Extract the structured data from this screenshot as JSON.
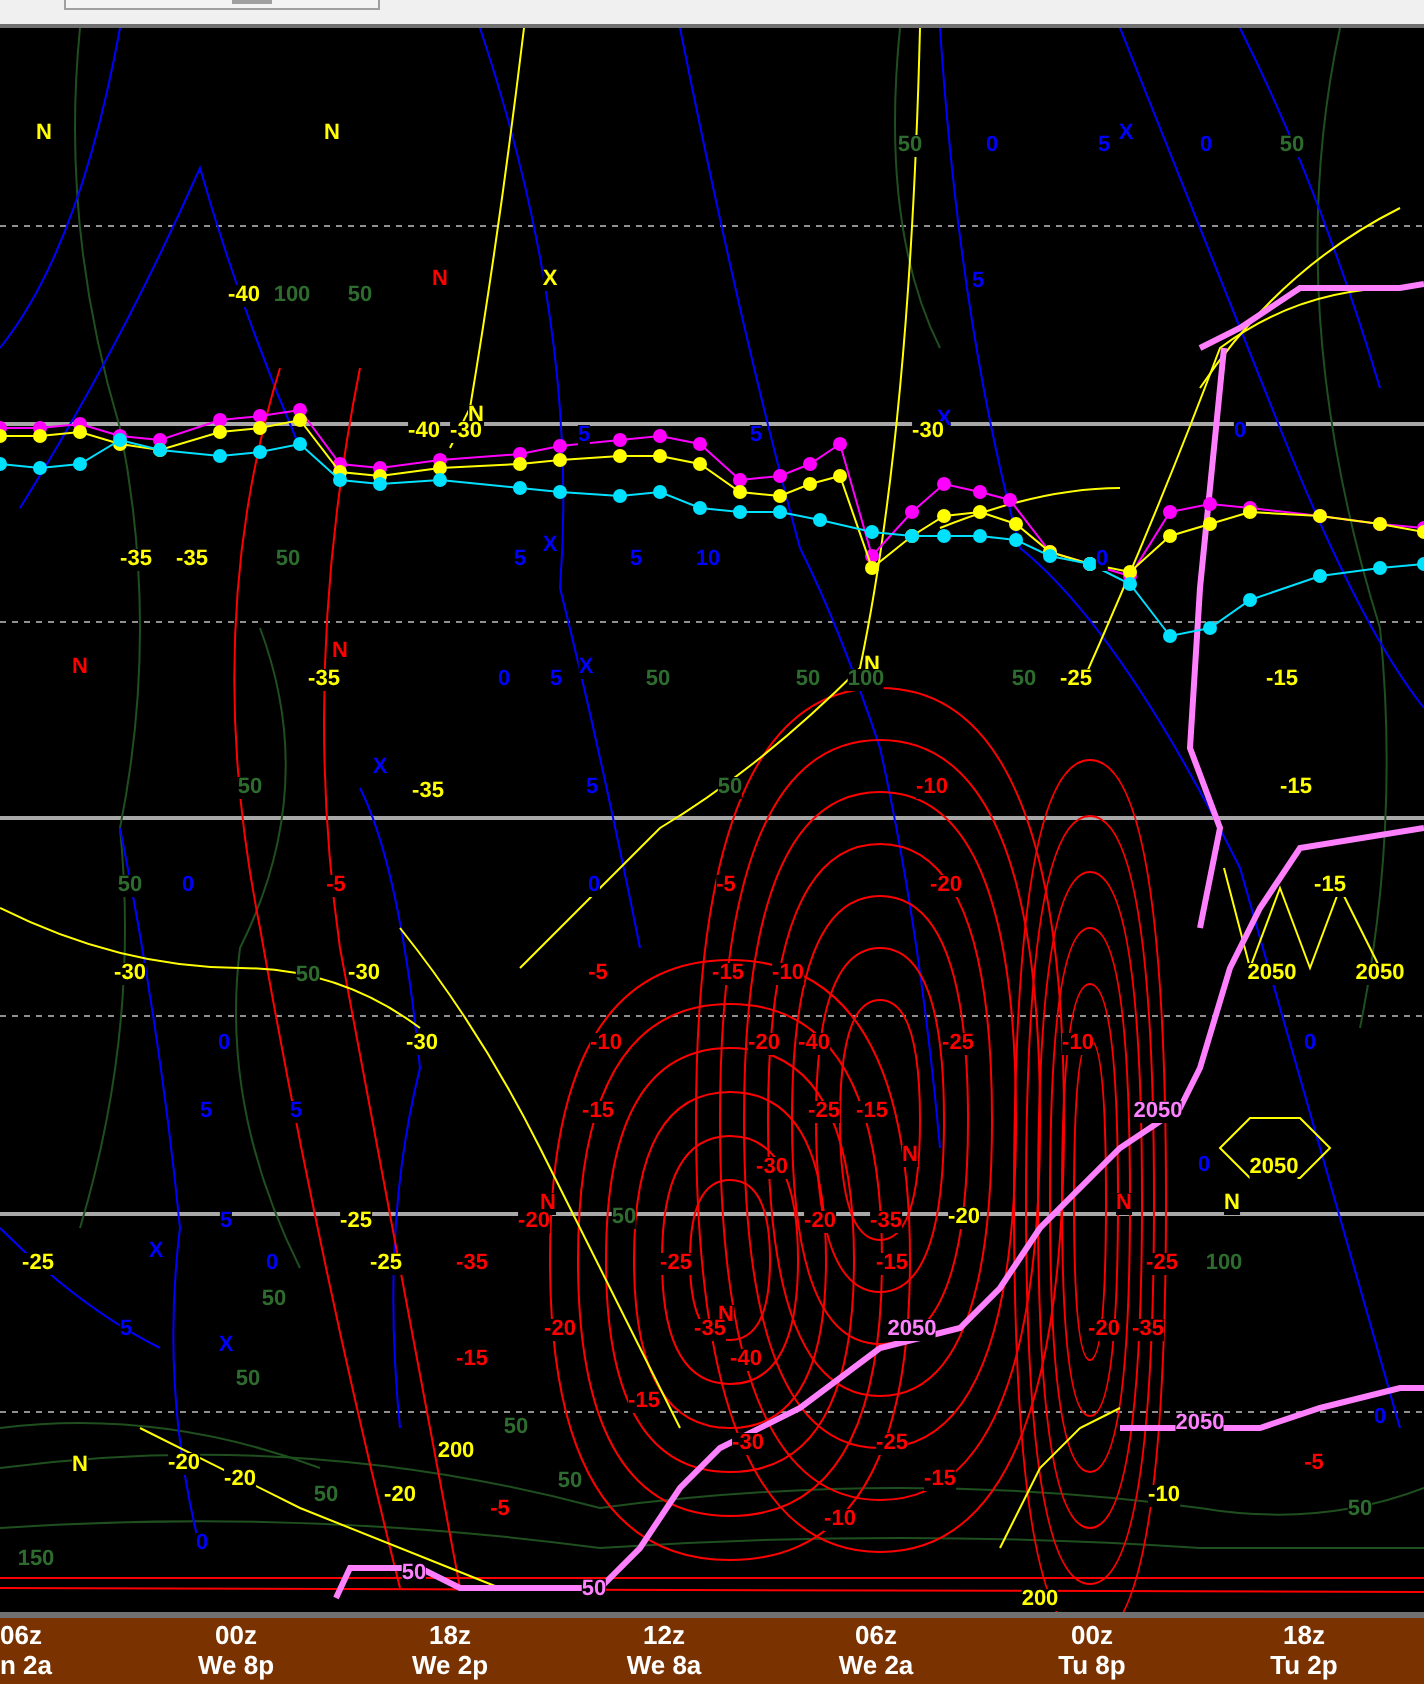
{
  "time_axis": [
    {
      "hour": "06z",
      "day": "n 2a"
    },
    {
      "hour": "00z",
      "day": "We 8p"
    },
    {
      "hour": "18z",
      "day": "We 2p"
    },
    {
      "hour": "12z",
      "day": "We 8a"
    },
    {
      "hour": "06z",
      "day": "We 2a"
    },
    {
      "hour": "00z",
      "day": "Tu 8p"
    },
    {
      "hour": "18z",
      "day": "Tu 2p"
    }
  ],
  "plot_labels": [
    {
      "text": "N",
      "color": "#ffff00"
    },
    {
      "text": "N",
      "color": "#ffff00"
    },
    {
      "text": "N",
      "color": "#ffff00"
    },
    {
      "text": "N",
      "color": "#ffff00"
    },
    {
      "text": "N",
      "color": "#ffff00"
    },
    {
      "text": "N",
      "color": "#ffff00"
    },
    {
      "text": "N",
      "color": "#ff0000"
    },
    {
      "text": "N",
      "color": "#ff0000"
    },
    {
      "text": "N",
      "color": "#ff0000"
    },
    {
      "text": "N",
      "color": "#ff0000"
    },
    {
      "text": "N",
      "color": "#ff0000"
    },
    {
      "text": "N",
      "color": "#ff0000"
    },
    {
      "text": "N",
      "color": "#ff0000"
    },
    {
      "text": "X",
      "color": "#ffff00"
    },
    {
      "text": "X",
      "color": "#0000ff"
    },
    {
      "text": "X",
      "color": "#0000ff"
    },
    {
      "text": "X",
      "color": "#0000ff"
    },
    {
      "text": "X",
      "color": "#0000ff"
    },
    {
      "text": "X",
      "color": "#0000ff"
    },
    {
      "text": "X",
      "color": "#0000ff"
    },
    {
      "text": "X",
      "color": "#0000ff"
    },
    {
      "text": "0",
      "color": "#0000ff"
    },
    {
      "text": "5",
      "color": "#0000ff"
    },
    {
      "text": "0",
      "color": "#0000ff"
    },
    {
      "text": "5",
      "color": "#0000ff"
    },
    {
      "text": "5",
      "color": "#0000ff"
    },
    {
      "text": "0",
      "color": "#0000ff"
    },
    {
      "text": "5",
      "color": "#0000ff"
    },
    {
      "text": "5",
      "color": "#0000ff"
    },
    {
      "text": "10",
      "color": "#0000ff"
    },
    {
      "text": "0",
      "color": "#0000ff"
    },
    {
      "text": "0",
      "color": "#0000ff"
    },
    {
      "text": "5",
      "color": "#0000ff"
    },
    {
      "text": "5",
      "color": "#0000ff"
    },
    {
      "text": "0",
      "color": "#0000ff"
    },
    {
      "text": "0",
      "color": "#0000ff"
    },
    {
      "text": "0",
      "color": "#0000ff"
    },
    {
      "text": "5",
      "color": "#0000ff"
    },
    {
      "text": "5",
      "color": "#0000ff"
    },
    {
      "text": "5",
      "color": "#0000ff"
    },
    {
      "text": "0",
      "color": "#0000ff"
    },
    {
      "text": "5",
      "color": "#0000ff"
    },
    {
      "text": "0",
      "color": "#0000ff"
    },
    {
      "text": "5",
      "color": "#0000ff"
    },
    {
      "text": "0",
      "color": "#0000ff"
    },
    {
      "text": "0",
      "color": "#0000ff"
    },
    {
      "text": "0",
      "color": "#0000ff"
    },
    {
      "text": "50",
      "color": "#2e6b2e"
    },
    {
      "text": "50",
      "color": "#2e6b2e"
    },
    {
      "text": "50",
      "color": "#2e6b2e"
    },
    {
      "text": "50",
      "color": "#2e6b2e"
    },
    {
      "text": "50",
      "color": "#2e6b2e"
    },
    {
      "text": "50",
      "color": "#2e6b2e"
    },
    {
      "text": "50",
      "color": "#2e6b2e"
    },
    {
      "text": "50",
      "color": "#2e6b2e"
    },
    {
      "text": "50",
      "color": "#2e6b2e"
    },
    {
      "text": "50",
      "color": "#2e6b2e"
    },
    {
      "text": "50",
      "color": "#2e6b2e"
    },
    {
      "text": "50",
      "color": "#2e6b2e"
    },
    {
      "text": "50",
      "color": "#2e6b2e"
    },
    {
      "text": "50",
      "color": "#2e6b2e"
    },
    {
      "text": "50",
      "color": "#2e6b2e"
    },
    {
      "text": "50",
      "color": "#2e6b2e"
    },
    {
      "text": "50",
      "color": "#2e6b2e"
    },
    {
      "text": "50",
      "color": "#2e6b2e"
    },
    {
      "text": "100",
      "color": "#2e6b2e"
    },
    {
      "text": "100",
      "color": "#2e6b2e"
    },
    {
      "text": "100",
      "color": "#2e6b2e"
    },
    {
      "text": "150",
      "color": "#2e6b2e"
    },
    {
      "text": "-40",
      "color": "#ffff00"
    },
    {
      "text": "-40",
      "color": "#ffff00"
    },
    {
      "text": "-30",
      "color": "#ffff00"
    },
    {
      "text": "-30",
      "color": "#ffff00"
    },
    {
      "text": "-35",
      "color": "#ffff00"
    },
    {
      "text": "-35",
      "color": "#ffff00"
    },
    {
      "text": "-35",
      "color": "#ffff00"
    },
    {
      "text": "-35",
      "color": "#ffff00"
    },
    {
      "text": "-30",
      "color": "#ffff00"
    },
    {
      "text": "-30",
      "color": "#ffff00"
    },
    {
      "text": "-30",
      "color": "#ffff00"
    },
    {
      "text": "-25",
      "color": "#ffff00"
    },
    {
      "text": "-25",
      "color": "#ffff00"
    },
    {
      "text": "-25",
      "color": "#ffff00"
    },
    {
      "text": "-20",
      "color": "#ffff00"
    },
    {
      "text": "-20",
      "color": "#ffff00"
    },
    {
      "text": "-20",
      "color": "#ffff00"
    },
    {
      "text": "200",
      "color": "#ffff00"
    },
    {
      "text": "-10",
      "color": "#ffff00"
    },
    {
      "text": "2050",
      "color": "#ffff00"
    },
    {
      "text": "2050",
      "color": "#ffff00"
    },
    {
      "text": "2050",
      "color": "#ffff00"
    },
    {
      "text": "-20",
      "color": "#ffff00"
    },
    {
      "text": "-25",
      "color": "#ffff00"
    },
    {
      "text": "-15",
      "color": "#ffff00"
    },
    {
      "text": "-15",
      "color": "#ffff00"
    },
    {
      "text": "-15",
      "color": "#ffff00"
    },
    {
      "text": "200",
      "color": "#ffff00"
    },
    {
      "text": "-5",
      "color": "#ff0000"
    },
    {
      "text": "-5",
      "color": "#ff0000"
    },
    {
      "text": "-10",
      "color": "#ff0000"
    },
    {
      "text": "-5",
      "color": "#ff0000"
    },
    {
      "text": "-15",
      "color": "#ff0000"
    },
    {
      "text": "-10",
      "color": "#ff0000"
    },
    {
      "text": "-20",
      "color": "#ff0000"
    },
    {
      "text": "-10",
      "color": "#ff0000"
    },
    {
      "text": "-20",
      "color": "#ff0000"
    },
    {
      "text": "-40",
      "color": "#ff0000"
    },
    {
      "text": "-25",
      "color": "#ff0000"
    },
    {
      "text": "-10",
      "color": "#ff0000"
    },
    {
      "text": "-15",
      "color": "#ff0000"
    },
    {
      "text": "-25",
      "color": "#ff0000"
    },
    {
      "text": "-15",
      "color": "#ff0000"
    },
    {
      "text": "-30",
      "color": "#ff0000"
    },
    {
      "text": "-20",
      "color": "#ff0000"
    },
    {
      "text": "-20",
      "color": "#ff0000"
    },
    {
      "text": "-35",
      "color": "#ff0000"
    },
    {
      "text": "-35",
      "color": "#ff0000"
    },
    {
      "text": "-25",
      "color": "#ff0000"
    },
    {
      "text": "-15",
      "color": "#ff0000"
    },
    {
      "text": "-25",
      "color": "#ff0000"
    },
    {
      "text": "-20",
      "color": "#ff0000"
    },
    {
      "text": "-35",
      "color": "#ff0000"
    },
    {
      "text": "-20",
      "color": "#ff0000"
    },
    {
      "text": "-35",
      "color": "#ff0000"
    },
    {
      "text": "-15",
      "color": "#ff0000"
    },
    {
      "text": "-40",
      "color": "#ff0000"
    },
    {
      "text": "-15",
      "color": "#ff0000"
    },
    {
      "text": "-30",
      "color": "#ff0000"
    },
    {
      "text": "-25",
      "color": "#ff0000"
    },
    {
      "text": "-5",
      "color": "#ff0000"
    },
    {
      "text": "-5",
      "color": "#ff0000"
    },
    {
      "text": "-10",
      "color": "#ff0000"
    },
    {
      "text": "-15",
      "color": "#ff0000"
    },
    {
      "text": "50",
      "color": "#ff80ff"
    },
    {
      "text": "50",
      "color": "#ff80ff"
    },
    {
      "text": "2050",
      "color": "#ff80ff"
    },
    {
      "text": "2050",
      "color": "#ff80ff"
    },
    {
      "text": "2050",
      "color": "#ff80ff"
    }
  ]
}
